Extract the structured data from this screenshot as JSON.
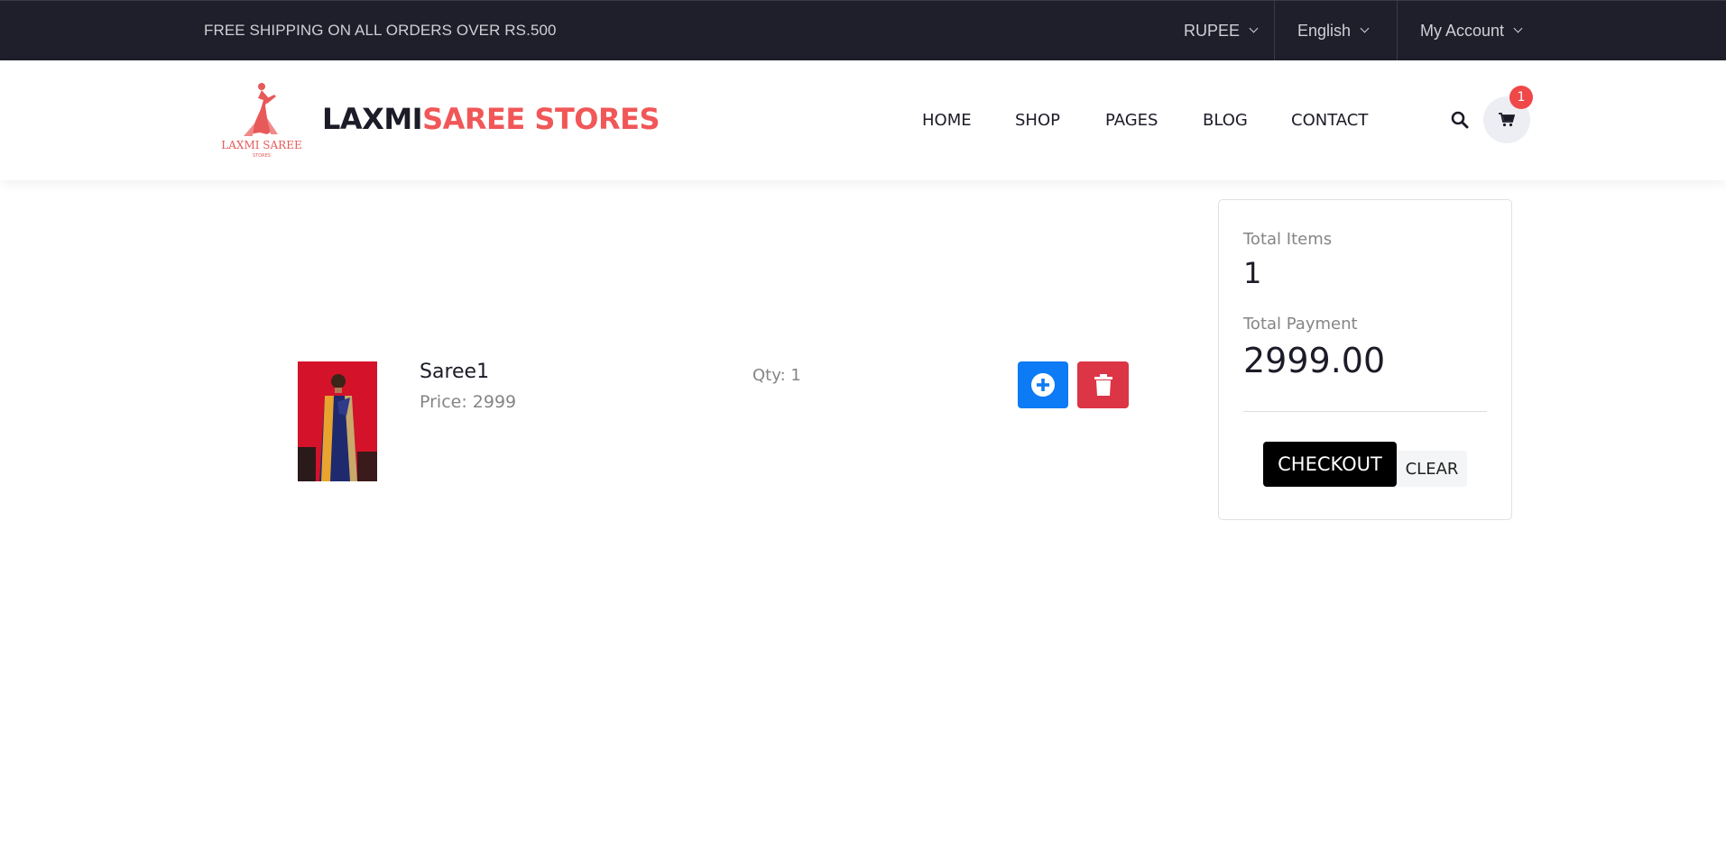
{
  "topbar": {
    "promo": "FREE SHIPPING ON ALL ORDERS OVER RS.500",
    "currency": "RUPEE",
    "language": "English",
    "account": "My Account"
  },
  "header": {
    "logo_text": "LAXMI SAREE",
    "logo_subtext": "STORES",
    "brand_part1": "LAXMI",
    "brand_part2": "SAREE STORES",
    "nav": [
      "HOME",
      "SHOP",
      "PAGES",
      "BLOG",
      "CONTACT"
    ],
    "cart_count": "1",
    "brand_colors": {
      "dark": "#1c1c28",
      "accent": "#f15758"
    }
  },
  "cart": {
    "items": [
      {
        "name": "Saree1",
        "price": "Price: 2999",
        "qty": "Qty: 1"
      }
    ]
  },
  "summary": {
    "total_items_label": "Total Items",
    "total_items": "1",
    "total_payment_label": "Total Payment",
    "total_payment": "2999.00",
    "checkout_label": "CHECKOUT",
    "clear_label": "CLEAR"
  },
  "icons": {
    "search": "search-icon",
    "cart": "cart-icon",
    "add": "plus-circle-icon",
    "delete": "trash-icon"
  },
  "colors": {
    "topbar_bg": "#1f1f2b",
    "add_button": "#0d7bf5",
    "delete_button": "#dc3545",
    "badge": "#f04848"
  }
}
